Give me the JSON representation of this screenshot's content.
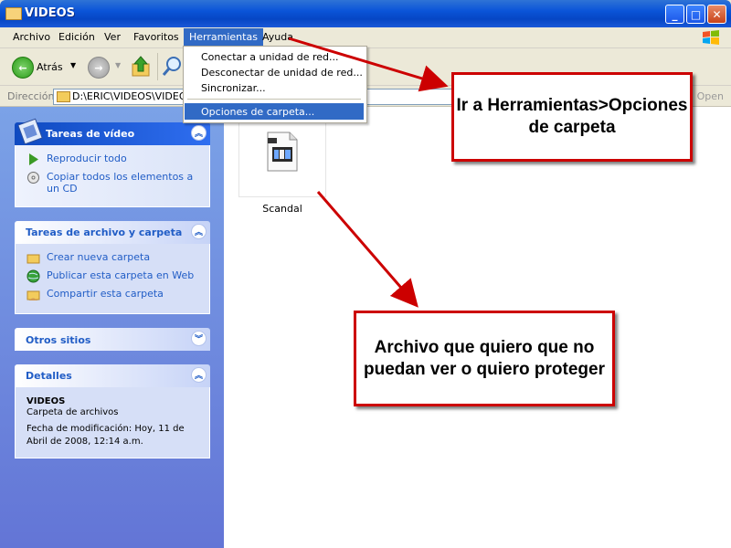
{
  "window": {
    "title": "VIDEOS"
  },
  "menubar": {
    "items": [
      "Archivo",
      "Edición",
      "Ver",
      "Favoritos",
      "Herramientas",
      "Ayuda"
    ]
  },
  "toolbar": {
    "back_label": "Atrás"
  },
  "address": {
    "label": "Dirección",
    "path": "D:\\ERIC\\VIDEOS\\VIDEOS",
    "go_label": "Open"
  },
  "tools_menu": {
    "items": [
      "Conectar a unidad de red...",
      "Desconectar de unidad de red...",
      "Sincronizar...",
      "Opciones de carpeta..."
    ],
    "selected": "Opciones de carpeta..."
  },
  "panels": {
    "video_tasks": {
      "title": "Tareas de vídeo",
      "items": [
        "Reproducir todo",
        "Copiar todos los elementos a un CD"
      ]
    },
    "file_tasks": {
      "title": "Tareas de archivo y carpeta",
      "items": [
        "Crear nueva carpeta",
        "Publicar esta carpeta en Web",
        "Compartir esta carpeta"
      ]
    },
    "other_places": {
      "title": "Otros sitios"
    },
    "details": {
      "title": "Detalles",
      "name": "VIDEOS",
      "type": "Carpeta de archivos",
      "modified": "Fecha de modificación: Hoy, 11 de Abril de 2008, 12:14 a.m."
    }
  },
  "files": [
    {
      "name": "Scandal",
      "icon": "video-file-icon"
    }
  ],
  "annotations": {
    "callout_1": "Ir a Herramientas>Opciones de carpeta",
    "callout_2": "Archivo que quiero que no puedan ver o quiero proteger",
    "color": "#cc0000"
  }
}
